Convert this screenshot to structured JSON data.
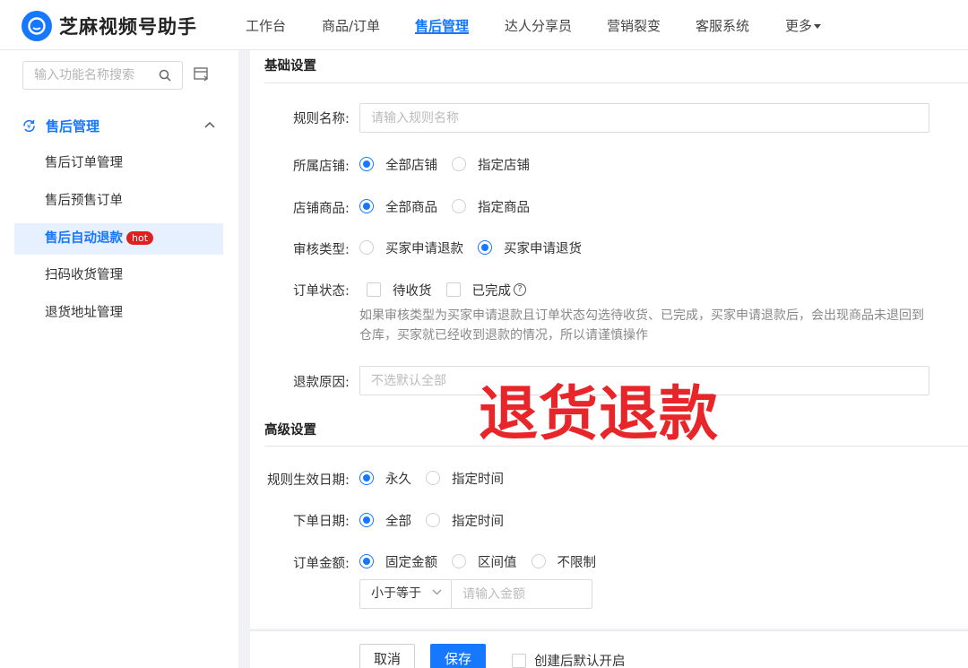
{
  "app": {
    "title": "芝麻视频号助手"
  },
  "nav": {
    "items": [
      "工作台",
      "商品/订单",
      "售后管理",
      "达人分享员",
      "营销裂变",
      "客服系统",
      "更多"
    ],
    "active_index": 2
  },
  "sidebar": {
    "search_placeholder": "输入功能名称搜索",
    "group_label": "售后管理",
    "items": [
      {
        "label": "售后订单管理"
      },
      {
        "label": "售后预售订单"
      },
      {
        "label": "售后自动退款",
        "badge": "hot",
        "active": true
      },
      {
        "label": "扫码收货管理"
      },
      {
        "label": "退货地址管理"
      }
    ]
  },
  "form": {
    "basic_title": "基础设置",
    "rule_name": {
      "label": "规则名称:",
      "placeholder": "请输入规则名称",
      "value": ""
    },
    "store": {
      "label": "所属店铺:",
      "options": [
        "全部店铺",
        "指定店铺"
      ],
      "selected": "全部店铺"
    },
    "goods": {
      "label": "店铺商品:",
      "options": [
        "全部商品",
        "指定商品"
      ],
      "selected": "全部商品"
    },
    "review_type": {
      "label": "审核类型:",
      "options": [
        "买家申请退款",
        "买家申请退货"
      ],
      "selected": "买家申请退货"
    },
    "order_status": {
      "label": "订单状态:",
      "options": [
        "待收货",
        "已完成"
      ]
    },
    "hint": "如果审核类型为买家申请退款且订单状态勾选待收货、已完成，买家申请退款后，会出现商品未退回到仓库，买家就已经收到退款的情况，所以请谨慎操作",
    "refund_reason": {
      "label": "退款原因:",
      "placeholder": "不选默认全部"
    },
    "overlay": "退货退款",
    "advanced_title": "高级设置",
    "valid_date": {
      "label": "规则生效日期:",
      "options": [
        "永久",
        "指定时间"
      ],
      "selected": "永久"
    },
    "order_date": {
      "label": "下单日期:",
      "options": [
        "全部",
        "指定时间"
      ],
      "selected": "全部"
    },
    "order_amount": {
      "label": "订单金额:",
      "options": [
        "固定金额",
        "区间值",
        "不限制"
      ],
      "selected": "固定金额"
    },
    "compare": {
      "value": "小于等于"
    },
    "amount": {
      "placeholder": "请输入金额"
    }
  },
  "footer": {
    "cancel_label": "取消",
    "save_label": "保存",
    "default_open_label": "创建后默认开启"
  },
  "colors": {
    "accent": "#1677ff",
    "hot": "#e02020",
    "overlay": "#e8262a"
  }
}
